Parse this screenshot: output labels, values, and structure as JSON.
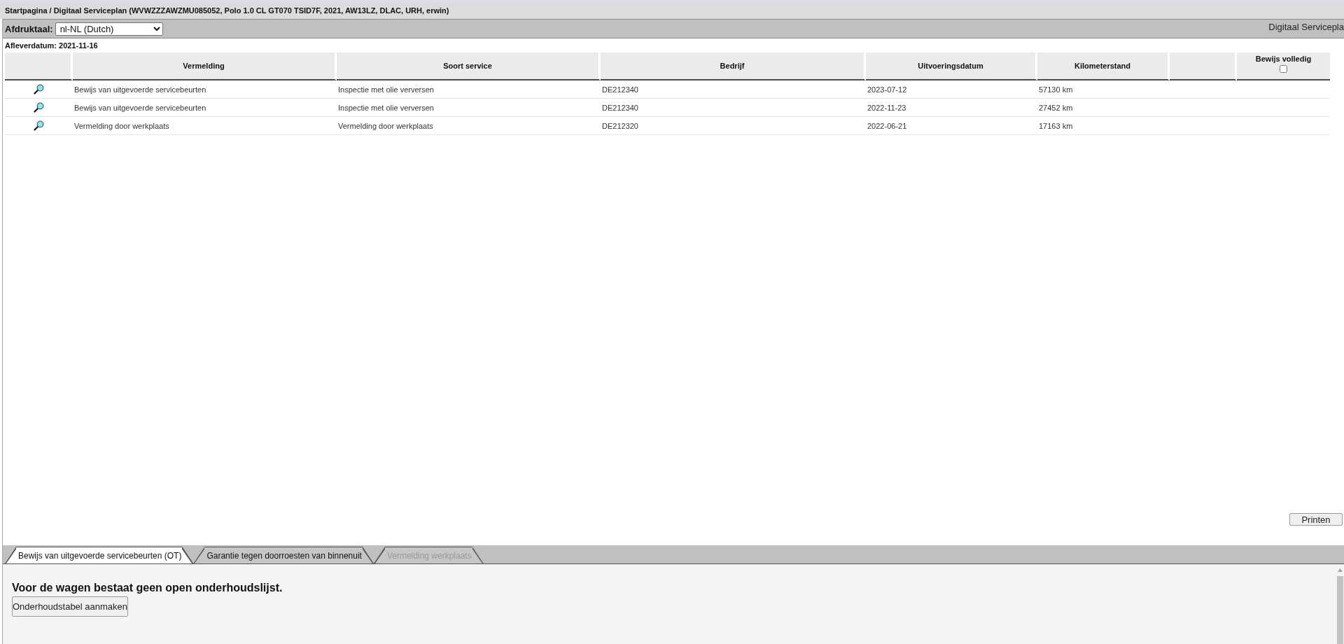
{
  "title_bar": {
    "breadcrumb": "Startpagina / Digitaal Serviceplan (WVWZZZAWZMU085052, Polo 1.0 CL GT070 TSID7F, 2021, AW13LZ, DLAC, URH, erwin)"
  },
  "toolbar": {
    "language_label": "Afdruktaal:",
    "language_value": "nl-NL (Dutch)",
    "page_title": "Digitaal Servicepla"
  },
  "delivery_date": "Afleverdatum: 2021-11-16",
  "table": {
    "columns": [
      {
        "kind": "icon"
      },
      {
        "kind": "text",
        "label": "Vermelding"
      },
      {
        "kind": "text",
        "label": "Soort service"
      },
      {
        "kind": "text",
        "label": "Bedrijf"
      },
      {
        "kind": "text",
        "label": "Uitvoeringsdatum"
      },
      {
        "kind": "text",
        "label": "Kilometerstand"
      },
      {
        "kind": "blank"
      },
      {
        "kind": "checkbox",
        "label": "Bewijs volledig",
        "checked": false
      }
    ],
    "rows": [
      {
        "cells": [
          "",
          "Bewijs van uitgevoerde servicebeurten",
          "Inspectie met olie verversen",
          "DE212340",
          "2023-07-12",
          "57130 km",
          "",
          ""
        ]
      },
      {
        "cells": [
          "",
          "Bewijs van uitgevoerde servicebeurten",
          "Inspectie met olie verversen",
          "DE212340",
          "2022-11-23",
          "27452 km",
          "",
          ""
        ]
      },
      {
        "cells": [
          "",
          "Vermelding door werkplaats",
          "Vermelding door werkplaats",
          "DE212320",
          "2022-06-21",
          "17163 km",
          "",
          ""
        ]
      }
    ]
  },
  "print_button": "Printen",
  "tabs": [
    {
      "label": "Bewijs van uitgevoerde servicebeurten (OT)",
      "selected": true,
      "disabled": false
    },
    {
      "label": "Garantie tegen doorroesten van binnenuit",
      "selected": false,
      "disabled": false
    },
    {
      "label": "Vermelding werkplaats",
      "selected": false,
      "disabled": true
    }
  ],
  "panel": {
    "message": "Voor de wagen bestaat geen open onderhoudslijst.",
    "button": "Onderhoudstabel aanmaken"
  }
}
